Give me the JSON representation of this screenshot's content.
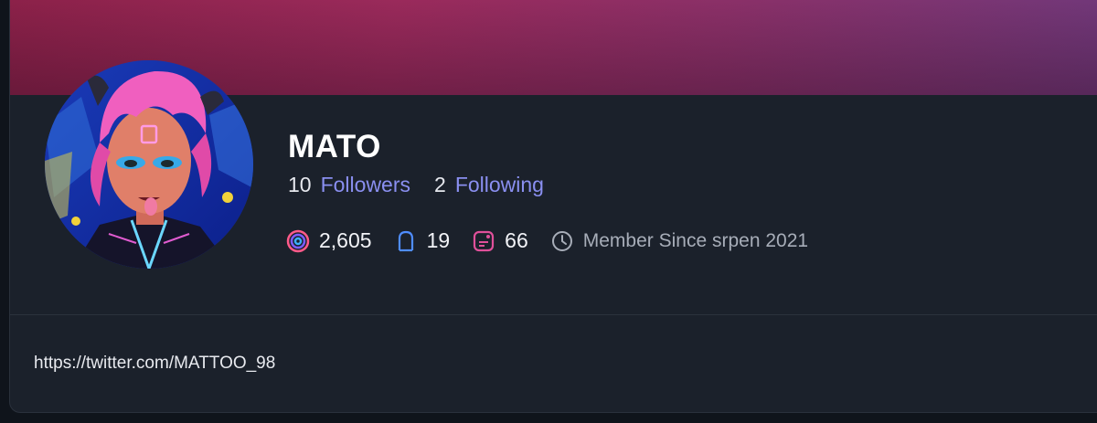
{
  "profile": {
    "name": "MATO",
    "followers_count": "10",
    "followers_label": "Followers",
    "following_count": "2",
    "following_label": "Following"
  },
  "stats": {
    "points": "2,605",
    "points_icon": "spiral-icon",
    "posts": "19",
    "posts_icon": "ghost-icon",
    "comments": "66",
    "comments_icon": "chat-icon",
    "member_since": "Member Since srpen 2021",
    "member_icon": "clock-icon"
  },
  "bio": {
    "link": "https://twitter.com/MATTOO_98"
  },
  "colors": {
    "banner_start": "#8c2149",
    "banner_end": "#70387a",
    "card_bg": "#1b212b",
    "link_color": "#8a8ff0",
    "avatar_hair": "#f05fbf"
  }
}
